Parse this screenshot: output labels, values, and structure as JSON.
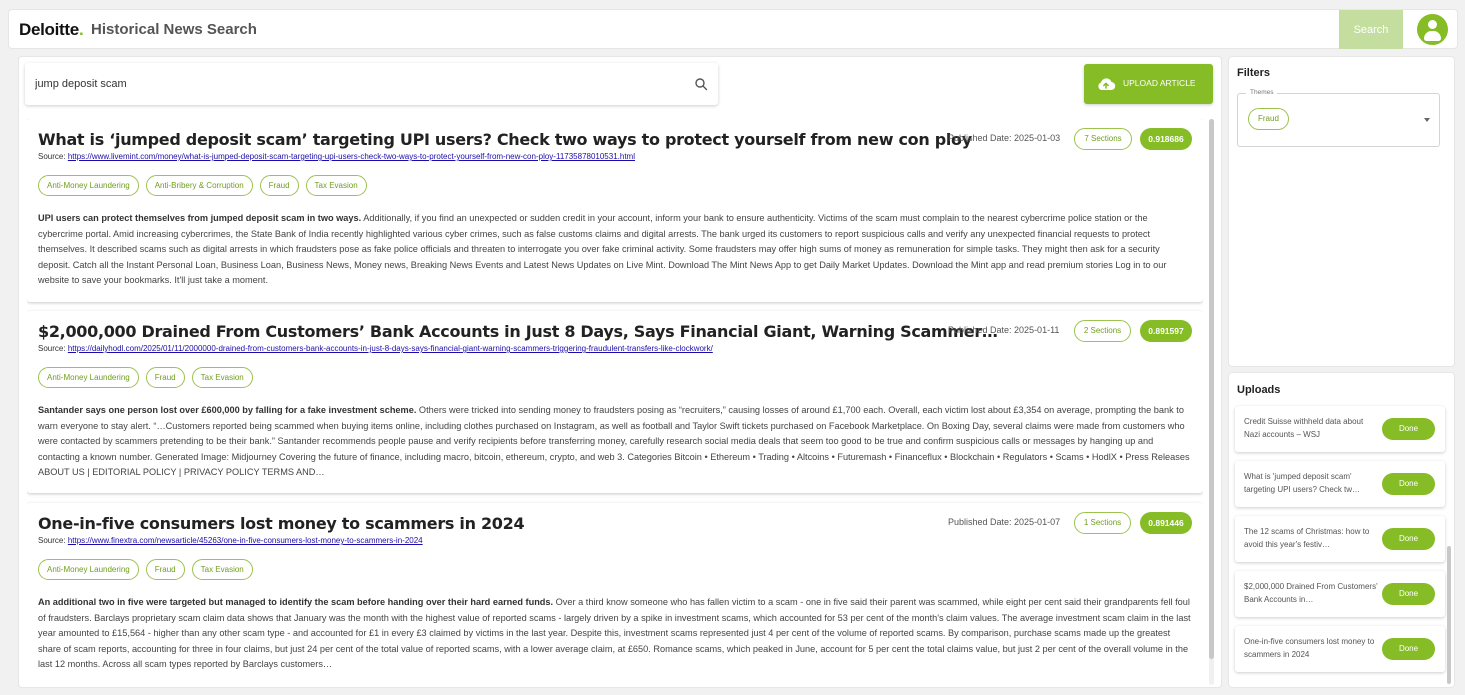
{
  "header": {
    "brand": "Deloitte",
    "brand_dot": ".",
    "title": "Historical News Search",
    "search_button": "Search"
  },
  "search": {
    "query": "jump deposit scam",
    "placeholder": ""
  },
  "upload_button": "UPLOAD ARTICLE",
  "results": [
    {
      "title": "What is ‘jumped deposit scam’ targeting UPI users? Check two ways to protect yourself from new con ploy",
      "source_label": "Source:",
      "source_url": "https://www.livemint.com/money/what-is-jumped-deposit-scam-targeting-upi-users-check-two-ways-to-protect-yourself-from-new-con-ploy-11735878010531.html",
      "published": "Published Date: 2025-01-03",
      "sections": "7 Sections",
      "score": "0.918686",
      "tags": [
        "Anti-Money Laundering",
        "Anti-Bribery & Corruption",
        "Fraud",
        "Tax Evasion"
      ],
      "summary_bold": "UPI users can protect themselves from jumped deposit scam in two ways.",
      "summary": " Additionally, if you find an unexpected or sudden credit in your account, inform your bank to ensure authenticity. Victims of the scam must complain to the nearest cybercrime police station or the cybercrime portal. Amid increasing cybercrimes, the State Bank of India recently highlighted various cyber crimes, such as false customs claims and digital arrests. The bank urged its customers to report suspicious calls and verify any unexpected financial requests to protect themselves. It described scams such as digital arrests in which fraudsters pose as fake police officials and threaten to interrogate you over fake criminal activity. Some fraudsters may offer high sums of money as remuneration for simple tasks. They might then ask for a security deposit. Catch all the Instant Personal Loan, Business Loan, Business News, Money news, Breaking News Events and Latest News Updates on Live Mint. Download The Mint News App to get Daily Market Updates. Download the Mint app and read premium stories Log in to our website to save your bookmarks. It'll just take a moment."
    },
    {
      "title": "$2,000,000 Drained From Customers’ Bank Accounts in Just 8 Days, Says Financial Giant, Warning Scammer…",
      "source_label": "Source:",
      "source_url": "https://dailyhodl.com/2025/01/11/2000000-drained-from-customers-bank-accounts-in-just-8-days-says-financial-giant-warning-scammers-triggering-fraudulent-transfers-like-clockwork/",
      "published": "Published Date: 2025-01-11",
      "sections": "2 Sections",
      "score": "0.891597",
      "tags": [
        "Anti-Money Laundering",
        "Fraud",
        "Tax Evasion"
      ],
      "summary_bold": "Santander says one person lost over £600,000 by falling for a fake investment scheme.",
      "summary": " Others were tricked into sending money to fraudsters posing as “recruiters,” causing losses of around £1,700 each. Overall, each victim lost about £3,354 on average, prompting the bank to warn everyone to stay alert. “…Customers reported being scammed when buying items online, including clothes purchased on Instagram, as well as football and Taylor Swift tickets purchased on Facebook Marketplace. On Boxing Day, several claims were made from customers who were contacted by scammers pretending to be their bank.” Santander recommends people pause and verify recipients before transferring money, carefully research social media deals that seem too good to be true and confirm suspicious calls or messages by hanging up and contacting a known number. Generated Image: Midjourney Covering the future of finance, including macro, bitcoin, ethereum, crypto, and web 3. Categories Bitcoin • Ethereum • Trading • Altcoins • Futuremash • Financeflux • Blockchain • Regulators • Scams • HodlX • Press Releases ABOUT US | EDITORIAL POLICY | PRIVACY POLICY TERMS AND…"
    },
    {
      "title": "One-in-five consumers lost money to scammers in 2024",
      "source_label": "Source:",
      "source_url": "https://www.finextra.com/newsarticle/45263/one-in-five-consumers-lost-money-to-scammers-in-2024",
      "published": "Published Date: 2025-01-07",
      "sections": "1 Sections",
      "score": "0.891446",
      "tags": [
        "Anti-Money Laundering",
        "Fraud",
        "Tax Evasion"
      ],
      "summary_bold": "An additional two in five were targeted but managed to identify the scam before handing over their hard earned funds.",
      "summary": " Over a third know someone who has fallen victim to a scam - one in five said their parent was scammed, while eight per cent said their grandparents fell foul of fraudsters. Barclays proprietary scam claim data shows that January was the month with the highest value of reported scams - largely driven by a spike in investment scams, which accounted for 53 per cent of the month's claim values. The average investment scam claim in the last year amounted to £15,564 - higher than any other scam type - and accounted for £1 in every £3 claimed by victims in the last year. Despite this, investment scams represented just 4 per cent of the volume of reported scams. By comparison, purchase scams made up the greatest share of scam reports, accounting for three in four claims, but just 24 per cent of the total value of reported scams, with a lower average claim, at £650. Romance scams, which peaked in June, account for 5 per cent the total claims value, but just 2 per cent of the overall volume in the last 12 months. Across all scam types reported by Barclays customers…"
    }
  ],
  "filters": {
    "title": "Filters",
    "themes_label": "Themes",
    "selected_theme": "Fraud"
  },
  "uploads": {
    "title": "Uploads",
    "items": [
      {
        "text": "Credit Suisse withheld data about Nazi accounts – WSJ",
        "status": "Done"
      },
      {
        "text": "What is 'jumped deposit scam' targeting UPI users? Check tw…",
        "status": "Done"
      },
      {
        "text": "The 12 scams of Christmas: how to avoid this year's festiv…",
        "status": "Done"
      },
      {
        "text": "$2,000,000 Drained From Customers' Bank Accounts in…",
        "status": "Done"
      },
      {
        "text": "One-in-five consumers lost money to scammers in 2024",
        "status": "Done"
      }
    ]
  },
  "colors": {
    "accent": "#86bc25",
    "accent_light": "#c4dea0",
    "link": "#1a0dab"
  }
}
